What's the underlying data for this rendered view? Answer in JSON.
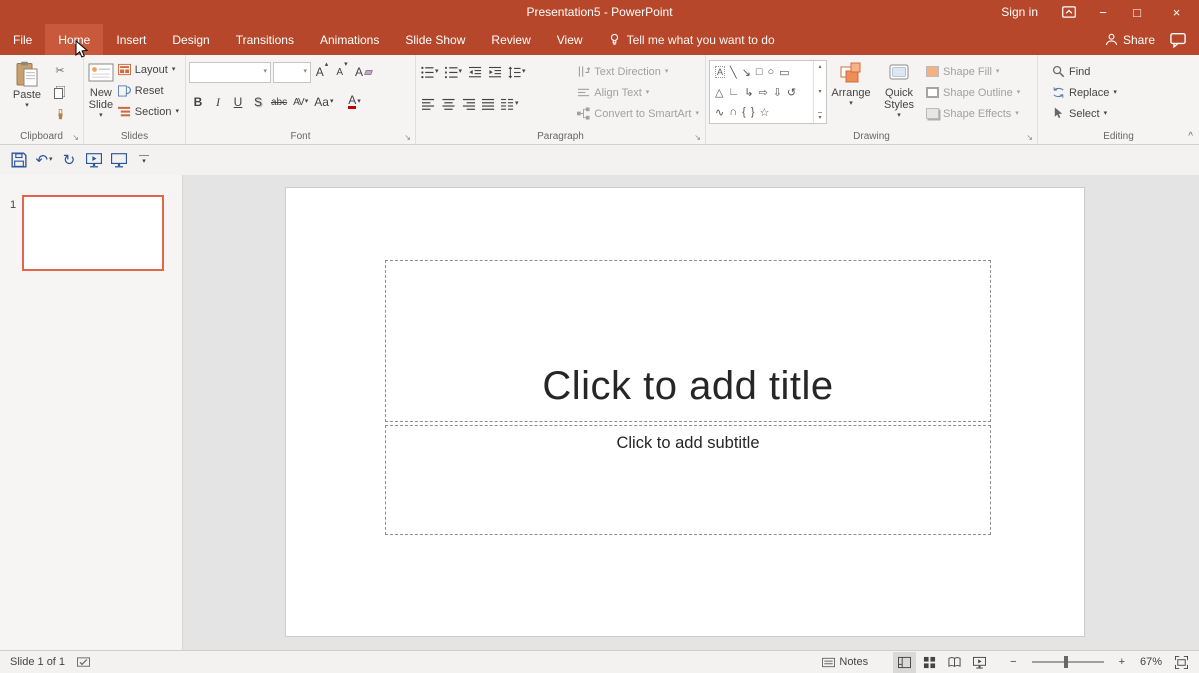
{
  "colors": {
    "brand": "#b7472a",
    "brand-light": "#c8593c",
    "accent": "#e2674a"
  },
  "titlebar": {
    "title": "Presentation5 - PowerPoint",
    "sign_in": "Sign in",
    "minimize": "−",
    "maximize": "□",
    "close": "×"
  },
  "tabs": {
    "items": [
      {
        "label": "File"
      },
      {
        "label": "Home"
      },
      {
        "label": "Insert"
      },
      {
        "label": "Design"
      },
      {
        "label": "Transitions"
      },
      {
        "label": "Animations"
      },
      {
        "label": "Slide Show"
      },
      {
        "label": "Review"
      },
      {
        "label": "View"
      }
    ],
    "tell_me": "Tell me what you want to do",
    "share": "Share"
  },
  "ribbon": {
    "clipboard": {
      "label": "Clipboard",
      "paste": "Paste"
    },
    "slides": {
      "label": "Slides",
      "new_slide": "New Slide",
      "layout": "Layout",
      "reset": "Reset",
      "section": "Section"
    },
    "font": {
      "label": "Font",
      "name_value": "",
      "size_value": "",
      "bold": "B",
      "italic": "I",
      "underline": "U",
      "shadow": "S",
      "strikethrough": "abc",
      "char_spacing": "AV",
      "change_case": "Aa",
      "font_color": "A",
      "grow": "A",
      "shrink": "A",
      "clear": "A"
    },
    "paragraph": {
      "label": "Paragraph",
      "text_direction": "Text Direction",
      "align_text": "Align Text",
      "convert_smartart": "Convert to SmartArt"
    },
    "drawing": {
      "label": "Drawing",
      "arrange": "Arrange",
      "quick_styles": "Quick Styles",
      "shape_fill": "Shape Fill",
      "shape_outline": "Shape Outline",
      "shape_effects": "Shape Effects",
      "shapes": [
        [
          "A",
          "╲",
          "↘",
          "□",
          "○",
          "▭"
        ],
        [
          "△",
          "∟",
          "↳",
          "⇨",
          "⇩",
          "↺"
        ],
        [
          "∿",
          "∩",
          "{",
          "}",
          "☆"
        ]
      ]
    },
    "editing": {
      "label": "Editing",
      "find": "Find",
      "replace": "Replace",
      "select": "Select"
    }
  },
  "qat_icons": {
    "undo": "↶",
    "redo": "↻"
  },
  "slides_panel": {
    "slide_number": "1"
  },
  "slide": {
    "title_placeholder": "Click to add title",
    "subtitle_placeholder": "Click to add subtitle"
  },
  "statusbar": {
    "slide_info": "Slide 1 of 1",
    "notes": "Notes",
    "zoom_minus": "−",
    "zoom_plus": "+",
    "zoom_level": "67%"
  },
  "glyphs": {
    "caret_down": "▾",
    "caret_up": "▴",
    "launcher": "↘",
    "collapse_ribbon": "^",
    "cut": "✂"
  }
}
